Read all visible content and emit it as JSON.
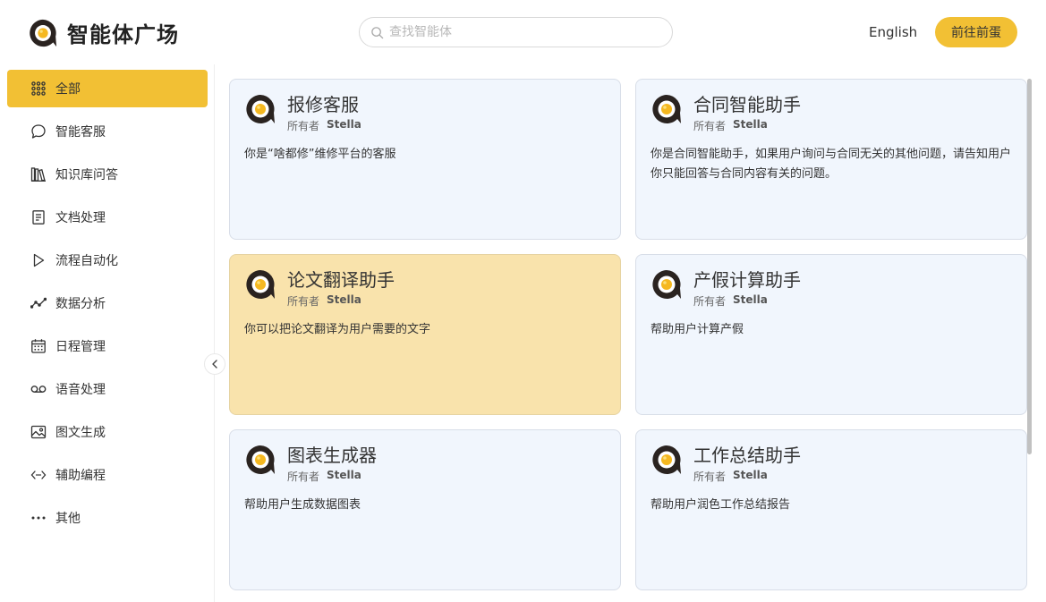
{
  "header": {
    "title": "智能体广场",
    "search_placeholder": "查找智能体",
    "language": "English",
    "cta_label": "前往前蛋"
  },
  "colors": {
    "accent": "#f2c034",
    "card_bg": "#f1f6fd",
    "card_highlight_bg": "#f9e3ac"
  },
  "sidebar": {
    "items": [
      {
        "label": "全部",
        "icon": "grid-icon"
      },
      {
        "label": "智能客服",
        "icon": "chat-bubble-icon"
      },
      {
        "label": "知识库问答",
        "icon": "books-icon"
      },
      {
        "label": "文档处理",
        "icon": "document-icon"
      },
      {
        "label": "流程自动化",
        "icon": "play-icon"
      },
      {
        "label": "数据分析",
        "icon": "trend-line-icon"
      },
      {
        "label": "日程管理",
        "icon": "calendar-icon"
      },
      {
        "label": "语音处理",
        "icon": "voicemail-icon"
      },
      {
        "label": "图文生成",
        "icon": "image-icon"
      },
      {
        "label": "辅助编程",
        "icon": "code-icon"
      },
      {
        "label": "其他",
        "icon": "more-dots-icon"
      }
    ]
  },
  "cards": [
    {
      "title": "报修客服",
      "owner_label": "所有者",
      "owner": "Stella",
      "desc": "你是“啥都修”维修平台的客服"
    },
    {
      "title": "合同智能助手",
      "owner_label": "所有者",
      "owner": "Stella",
      "desc": "你是合同智能助手，如果用户询问与合同无关的其他问题，请告知用户你只能回答与合同内容有关的问题。"
    },
    {
      "title": "论文翻译助手",
      "owner_label": "所有者",
      "owner": "Stella",
      "desc": "你可以把论文翻译为用户需要的文字"
    },
    {
      "title": "产假计算助手",
      "owner_label": "所有者",
      "owner": "Stella",
      "desc": "帮助用户计算产假"
    },
    {
      "title": "图表生成器",
      "owner_label": "所有者",
      "owner": "Stella",
      "desc": "帮助用户生成数据图表"
    },
    {
      "title": "工作总结助手",
      "owner_label": "所有者",
      "owner": "Stella",
      "desc": "帮助用户润色工作总结报告"
    }
  ]
}
